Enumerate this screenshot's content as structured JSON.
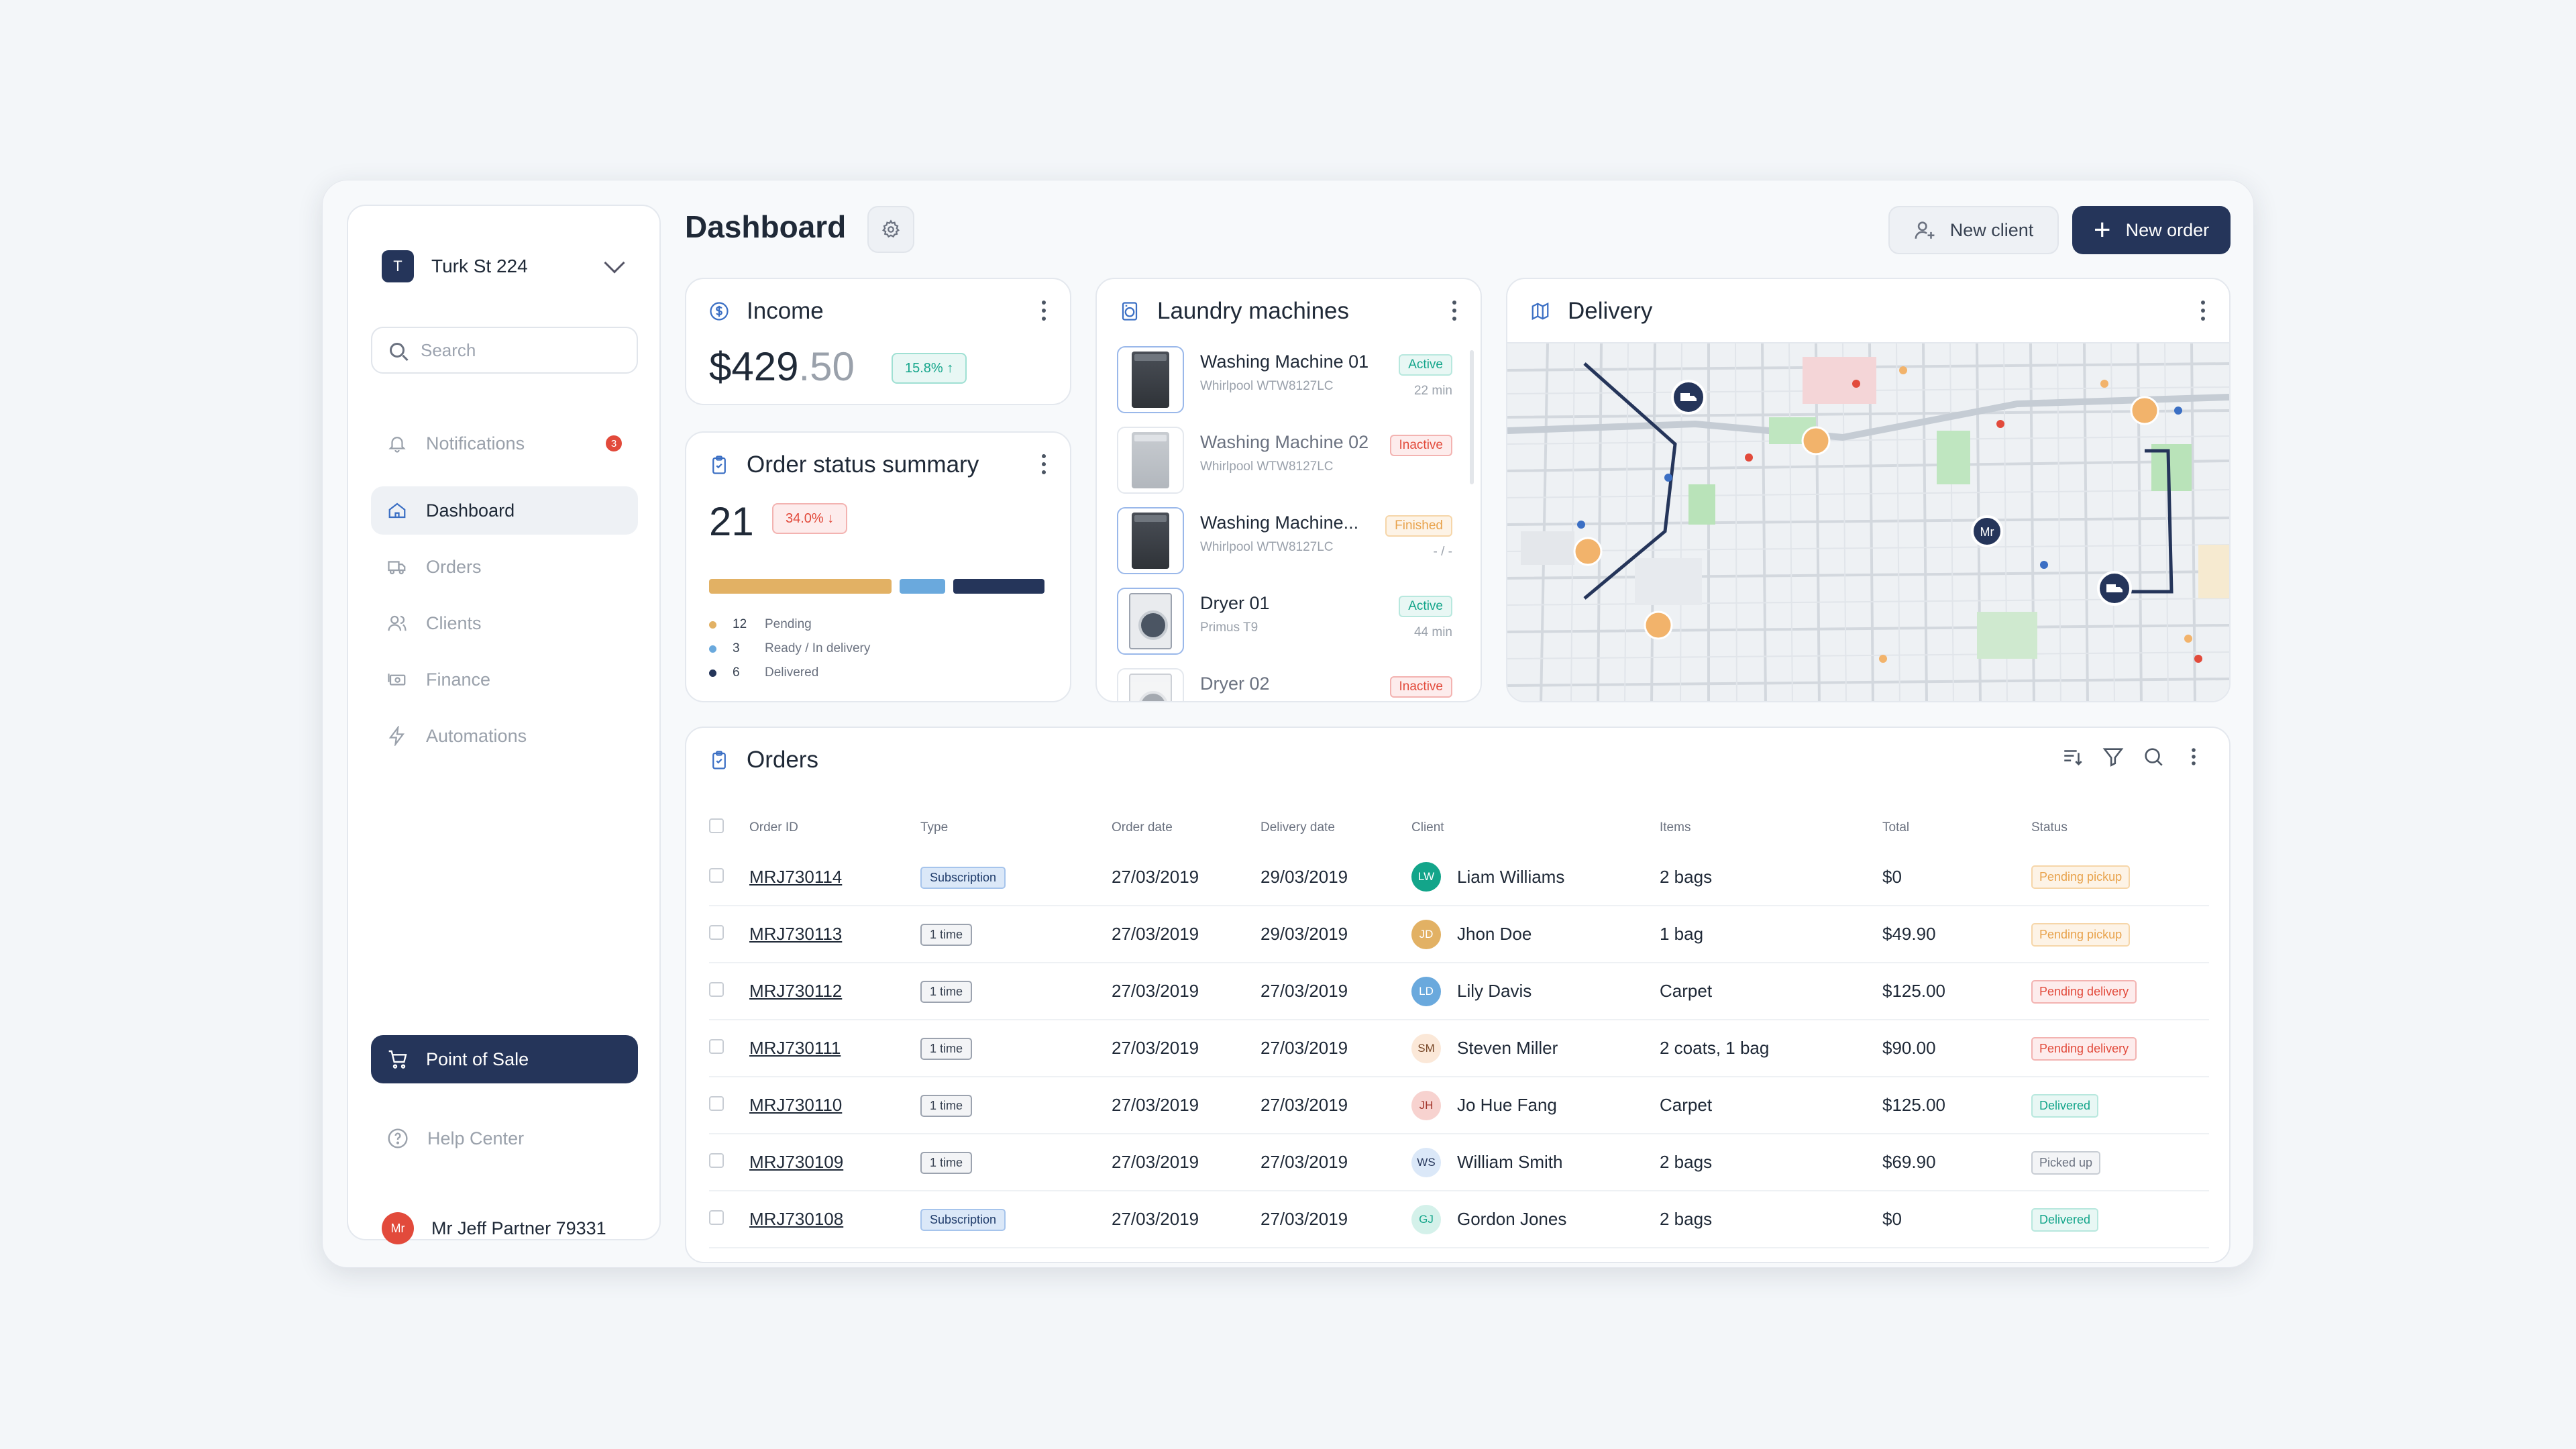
{
  "sidebar": {
    "workspace": {
      "initial": "T",
      "name": "Turk St 224"
    },
    "search_placeholder": "Search",
    "notifications": {
      "label": "Notifications",
      "count": "3"
    },
    "items": [
      {
        "label": "Dashboard"
      },
      {
        "label": "Orders"
      },
      {
        "label": "Clients"
      },
      {
        "label": "Finance"
      },
      {
        "label": "Automations"
      }
    ],
    "pos_label": "Point of Sale",
    "help_label": "Help Center",
    "user": {
      "initials": "Mr",
      "name": "Mr Jeff Partner 79331"
    }
  },
  "header": {
    "title": "Dashboard",
    "new_client": "New client",
    "new_order": "New order"
  },
  "income": {
    "title": "Income",
    "amount_main": "$429",
    "amount_cents": ".50",
    "change": "15.8% ↑"
  },
  "summary": {
    "title": "Order status summary",
    "total": "21",
    "change": "34.0% ↓",
    "legend": [
      {
        "count": "12",
        "label": "Pending",
        "color": "#e2b164",
        "value": 12
      },
      {
        "count": "3",
        "label": "Ready / In delivery",
        "color": "#6aa9dd",
        "value": 3
      },
      {
        "count": "6",
        "label": "Delivered",
        "color": "#25355a",
        "value": 6
      }
    ]
  },
  "machines": {
    "title": "Laundry machines",
    "items": [
      {
        "name": "Washing Machine 01",
        "model": "Whirlpool WTW8127LC",
        "status": "Active",
        "time": "22 min"
      },
      {
        "name": "Washing Machine 02",
        "model": "Whirlpool WTW8127LC",
        "status": "Inactive",
        "time": ""
      },
      {
        "name": "Washing Machine...",
        "model": "Whirlpool WTW8127LC",
        "status": "Finished",
        "time": "- / -"
      },
      {
        "name": "Dryer 01",
        "model": "Primus T9",
        "status": "Active",
        "time": "44 min"
      },
      {
        "name": "Dryer 02",
        "model": "",
        "status": "Inactive",
        "time": ""
      }
    ]
  },
  "delivery": {
    "title": "Delivery",
    "map_marker": "Mr"
  },
  "orders": {
    "title": "Orders",
    "columns": [
      "Order ID",
      "Type",
      "Order date",
      "Delivery date",
      "Client",
      "Items",
      "Total",
      "Status"
    ],
    "rows": [
      {
        "id": "MRJ730114",
        "type": "Subscription",
        "order_date": "27/03/2019",
        "delivery_date": "29/03/2019",
        "initials": "LW",
        "client": "Liam Williams",
        "items": "2 bags",
        "total": "$0",
        "status": "Pending pickup"
      },
      {
        "id": "MRJ730113",
        "type": "1 time",
        "order_date": "27/03/2019",
        "delivery_date": "29/03/2019",
        "initials": "JD",
        "client": "Jhon Doe",
        "items": "1 bag",
        "total": "$49.90",
        "status": "Pending pickup"
      },
      {
        "id": "MRJ730112",
        "type": "1 time",
        "order_date": "27/03/2019",
        "delivery_date": "27/03/2019",
        "initials": "LD",
        "client": "Lily Davis",
        "items": "Carpet",
        "total": "$125.00",
        "status": "Pending delivery"
      },
      {
        "id": "MRJ730111",
        "type": "1 time",
        "order_date": "27/03/2019",
        "delivery_date": "27/03/2019",
        "initials": "SM",
        "client": "Steven Miller",
        "items": "2 coats, 1 bag",
        "total": "$90.00",
        "status": "Pending delivery"
      },
      {
        "id": "MRJ730110",
        "type": "1 time",
        "order_date": "27/03/2019",
        "delivery_date": "27/03/2019",
        "initials": "JH",
        "client": "Jo Hue Fang",
        "items": "Carpet",
        "total": "$125.00",
        "status": "Delivered"
      },
      {
        "id": "MRJ730109",
        "type": "1 time",
        "order_date": "27/03/2019",
        "delivery_date": "27/03/2019",
        "initials": "WS",
        "client": "William Smith",
        "items": "2 bags",
        "total": "$69.90",
        "status": "Picked up"
      },
      {
        "id": "MRJ730108",
        "type": "Subscription",
        "order_date": "27/03/2019",
        "delivery_date": "27/03/2019",
        "initials": "GJ",
        "client": "Gordon Jones",
        "items": "2 bags",
        "total": "$0",
        "status": "Delivered"
      }
    ]
  },
  "colors": {
    "primary": "#25355a",
    "success": "#13a58a",
    "danger": "#e24a3b",
    "warning": "#e8a24b"
  }
}
